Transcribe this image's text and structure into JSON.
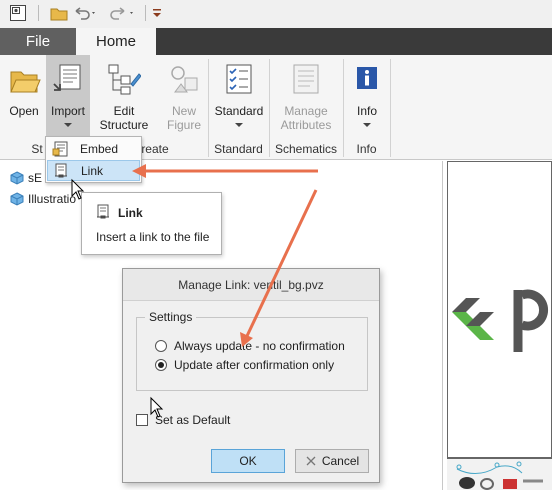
{
  "ribbon_tabs": {
    "file": "File",
    "home": "Home"
  },
  "ribbon": {
    "open": "Open",
    "import": "Import",
    "edit_structure_1": "Edit",
    "edit_structure_2": "Structure",
    "new_figure_1": "New",
    "new_figure_2": "Figure",
    "standard": "Standard",
    "manage_attributes_1": "Manage",
    "manage_attributes_2": "Attributes",
    "info": "Info",
    "groups": {
      "structure_partial": "St",
      "create_partial": "reate",
      "standard": "Standard",
      "schematics": "Schematics",
      "info": "Info"
    }
  },
  "import_menu": {
    "embed": "Embed",
    "link": "Link"
  },
  "tree": {
    "item1_partial": "sE",
    "item2_partial": "Illustratio"
  },
  "tooltip": {
    "title": "Link",
    "description": "Insert a link to the file"
  },
  "dialog": {
    "title": "Manage Link: ventil_bg.pvz",
    "settings_label": "Settings",
    "option_always": "Always update - no confirmation",
    "option_confirm": "Update after confirmation only",
    "selected_option": "option_confirm",
    "set_default_label": "Set as Default",
    "set_default_checked": false,
    "ok": "OK",
    "cancel": "Cancel"
  },
  "colors": {
    "annotation_arrow": "#e8704d",
    "highlight": "#cce4f7",
    "logo_dark": "#555555",
    "logo_green": "#5bb548",
    "tab_bar": "#3a3a3a"
  }
}
